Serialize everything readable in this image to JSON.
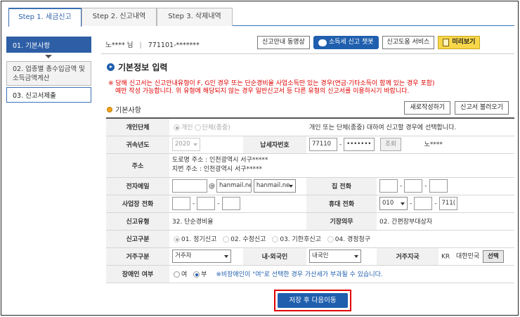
{
  "tabs": [
    {
      "label": "Step 1. 세금신고"
    },
    {
      "label": "Step 2. 신고내역"
    },
    {
      "label": "Step 3. 삭제내역"
    }
  ],
  "sidebar": {
    "items": [
      {
        "label": "01. 기본사항"
      },
      {
        "label_line1": "02. 업종별 총수입금액 및",
        "label_line2": "소득금액계산"
      },
      {
        "label": "03. 신고서제출"
      }
    ]
  },
  "header": {
    "user_name": "노**** 님",
    "separator": "|",
    "user_id": "771101-*******",
    "buttons": {
      "video": "신고안내 동영상",
      "chatbot": "소득세 신고 챗봇",
      "help": "신고도움 서비스",
      "preview": "미리보기"
    }
  },
  "section": {
    "title": "기본정보 입력",
    "notice_line1": "※ 당해 신고서는 신고안내유형이 F, G인 경우 또는 단순경비율 사업소득만 있는 경우(연금·기타소득이 함께 있는 경우 포함)",
    "notice_line2": "예만 작성 가능합니다. 위 유형에 해당되지 않는 경우 일반신고서 등 다른 유형의 신고서를 이용하시기 바랍니다.",
    "subtitle": "기본사항",
    "new_button": "새로작성하기",
    "load_button": "신고서 불러오기"
  },
  "form": {
    "taxpayer_type": {
      "label": "개인단체",
      "opt_personal": "개인",
      "opt_group": "단체(종중)",
      "hint": "개인 또는 단체(종중) 대하여 신고할 경우에 선택합니다."
    },
    "tax_year": {
      "label": "귀속년도",
      "value": "2020"
    },
    "taxpayer_no": {
      "label": "납세자번호",
      "part1": "77110",
      "part2": "•••••••",
      "lookup": "조회",
      "name": "노****"
    },
    "address": {
      "label": "주소",
      "road": "도로명 주소 :  인천광역시 서구*****",
      "lot": "지번 주소 :  인천광역시 서구*****"
    },
    "email": {
      "label": "전자메일",
      "at": "@",
      "domain": "hanmail.ne",
      "domain_select": "hanmail.ne"
    },
    "home_phone": {
      "label": "집 전화"
    },
    "biz_phone": {
      "label": "사업장 전화"
    },
    "mobile": {
      "label": "휴대 전화",
      "part1": "010",
      "part3": "711("
    },
    "report_type": {
      "label": "신고유형",
      "value": "32. 단순경비율"
    },
    "bookkeeping": {
      "label": "기장의무",
      "value": "02. 간편장부대상자"
    },
    "report_class": {
      "label": "신고구분",
      "opt1": "01. 정기신고",
      "opt2": "02. 수정신고",
      "opt3": "03. 기한후신고",
      "opt4": "04. 경정청구"
    },
    "residence": {
      "label": "거주구분",
      "value": "거주자"
    },
    "nationality": {
      "label": "내·외국인",
      "value": "내국인"
    },
    "country": {
      "label": "거주지국",
      "code": "KR",
      "name": "대한민국",
      "select": "선택"
    },
    "disabled": {
      "label": "장애인 여부",
      "yes": "여",
      "no": "부",
      "note": "※비장애인이 \"여\"로 선택한 경우 가산세가 부과될 수 있습니다."
    }
  },
  "save_button": "저장 후 다음이동"
}
